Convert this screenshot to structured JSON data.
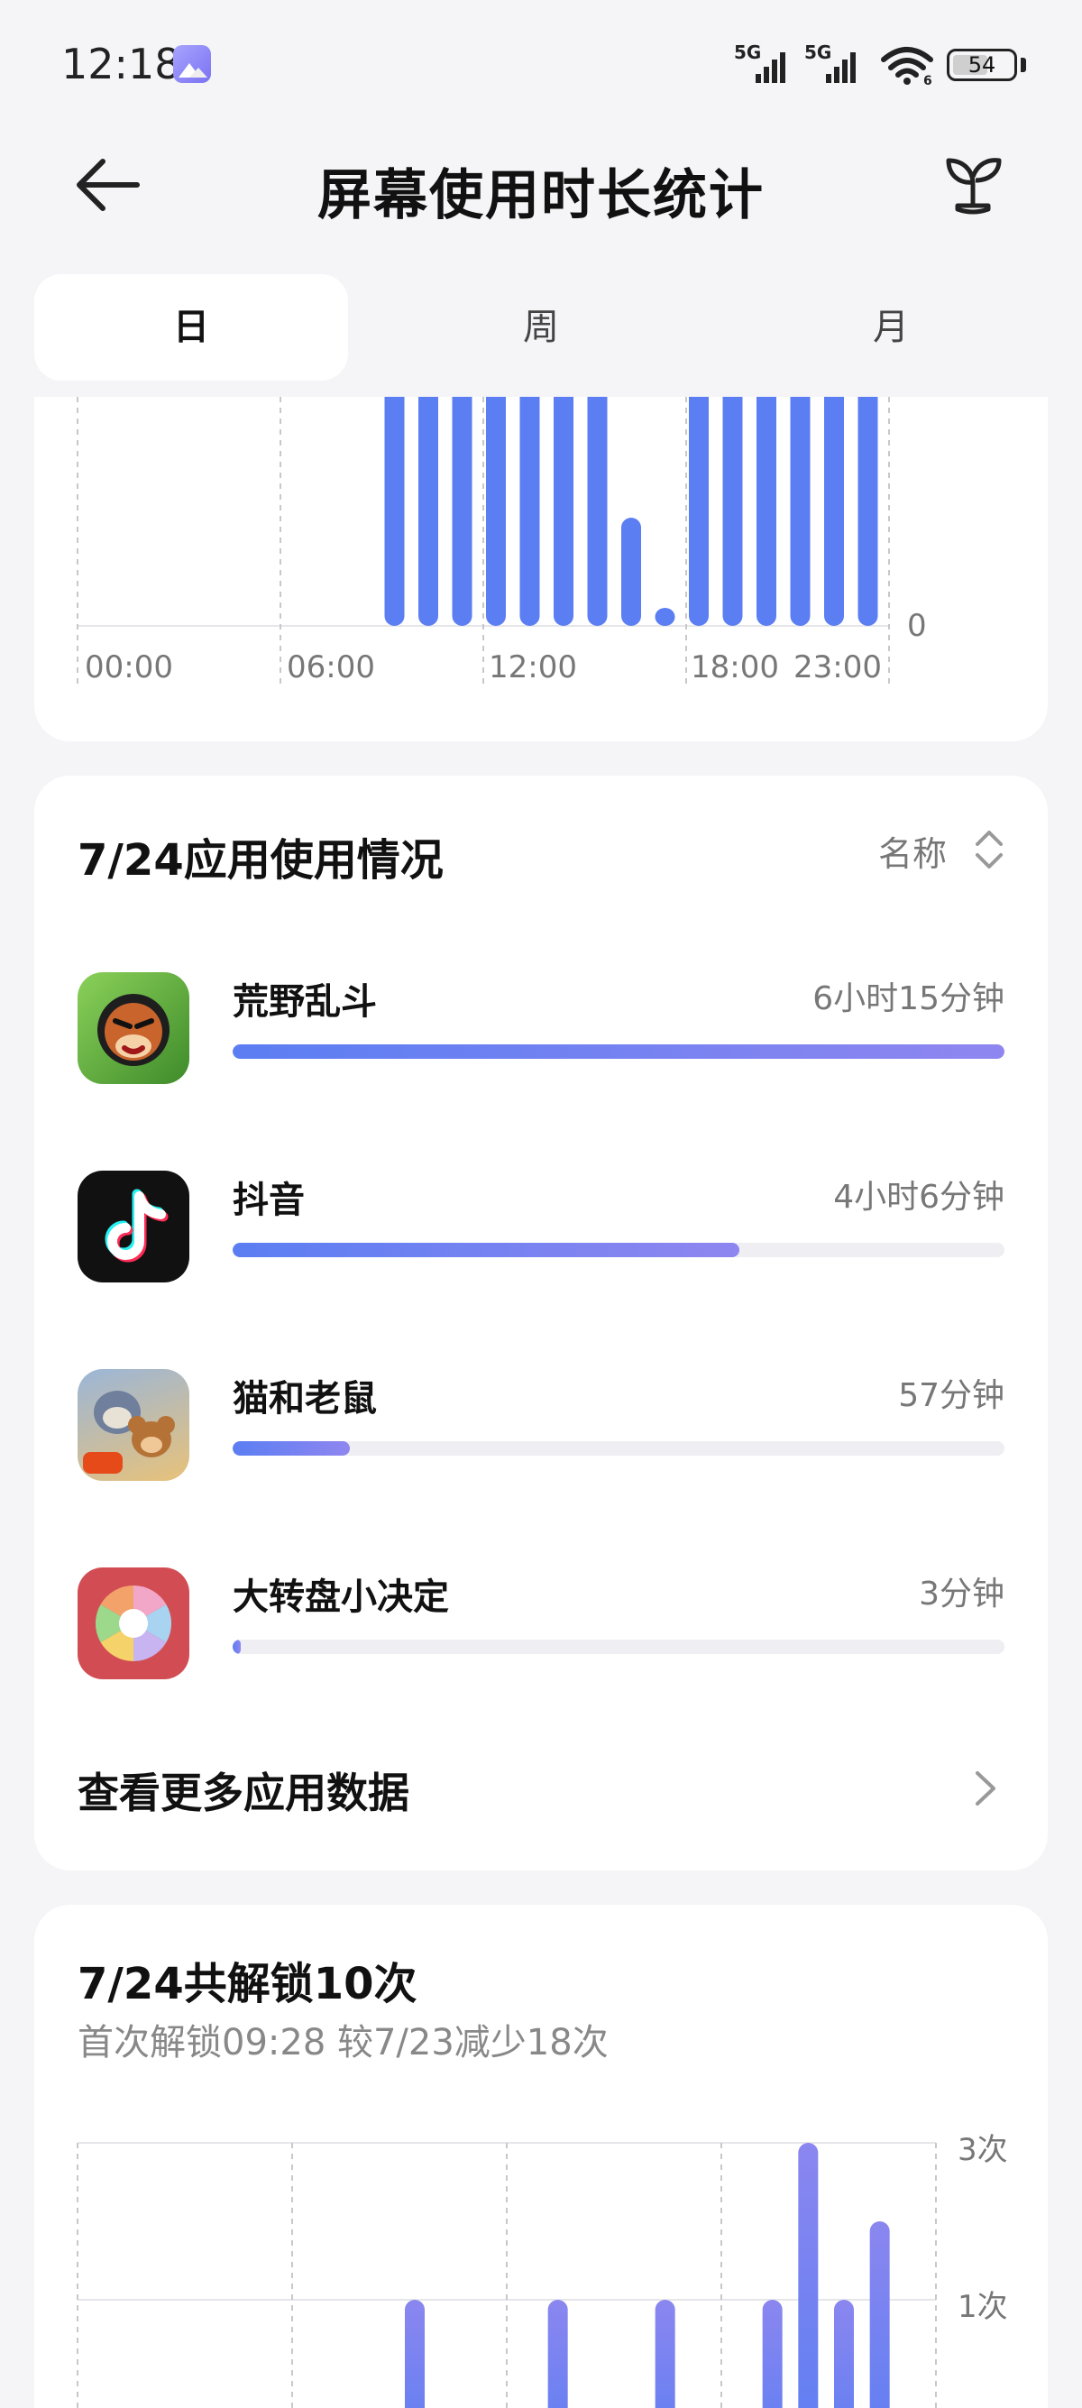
{
  "status_bar": {
    "time": "12:18",
    "signal1_label": "5G",
    "signal2_label": "5G",
    "battery": "54",
    "wifi_label": "6"
  },
  "header": {
    "title": "屏幕使用时长统计",
    "back_icon": "back-arrow-icon",
    "plant_icon": "sprout-icon"
  },
  "tabs": [
    {
      "label": "日",
      "active": true
    },
    {
      "label": "周",
      "active": false
    },
    {
      "label": "月",
      "active": false
    }
  ],
  "usage_chart": {
    "x_ticks": [
      "00:00",
      "06:00",
      "12:00",
      "18:00",
      "23:00"
    ],
    "y_zero": "0",
    "bar_color": "#5b7ef2"
  },
  "chart_data": [
    {
      "type": "bar",
      "categories": [
        "00",
        "01",
        "02",
        "03",
        "04",
        "05",
        "06",
        "07",
        "08",
        "09",
        "10",
        "11",
        "12",
        "13",
        "14",
        "15",
        "16",
        "17",
        "18",
        "19",
        "20",
        "21",
        "22",
        "23"
      ],
      "values": [
        0,
        0,
        0,
        0,
        0,
        0,
        0,
        0,
        0,
        1,
        1,
        1,
        1,
        1,
        1,
        1,
        0.3,
        0.05,
        1,
        1,
        1,
        1,
        1,
        1
      ],
      "xlabel": "",
      "ylabel": "",
      "x_ticks": [
        "00:00",
        "06:00",
        "12:00",
        "18:00",
        "23:00"
      ],
      "y_ticks": [
        "0"
      ]
    },
    {
      "type": "bar",
      "categories": [
        "00",
        "01",
        "02",
        "03",
        "04",
        "05",
        "06",
        "07",
        "08",
        "09",
        "10",
        "11",
        "12",
        "13",
        "14",
        "15",
        "16",
        "17",
        "18",
        "19",
        "20",
        "21",
        "22",
        "23"
      ],
      "values": [
        0,
        0,
        0,
        0,
        0,
        0,
        0,
        0,
        0,
        1,
        0,
        0,
        0,
        1,
        0,
        0,
        1,
        0,
        0,
        1,
        3,
        1,
        2,
        0
      ],
      "y_ticks": [
        "3次",
        "1次"
      ],
      "ylim": [
        0,
        3
      ]
    }
  ],
  "apps_section": {
    "title": "7/24应用使用情况",
    "sort_label": "名称",
    "items": [
      {
        "name": "荒野乱斗",
        "time": "6小时15分钟",
        "fraction": 1.0,
        "icon": "brawl-stars-icon"
      },
      {
        "name": "抖音",
        "time": "4小时6分钟",
        "fraction": 0.657,
        "icon": "douyin-icon"
      },
      {
        "name": "猫和老鼠",
        "time": "57分钟",
        "fraction": 0.152,
        "icon": "tom-and-jerry-icon"
      },
      {
        "name": "大转盘小决定",
        "time": "3分钟",
        "fraction": 0.01,
        "icon": "wheel-decision-icon"
      }
    ],
    "more_label": "查看更多应用数据"
  },
  "unlock_section": {
    "title": "7/24共解锁10次",
    "subtitle": "首次解锁09:28 较7/23减少18次",
    "y_top": "3次",
    "y_mid": "1次"
  }
}
